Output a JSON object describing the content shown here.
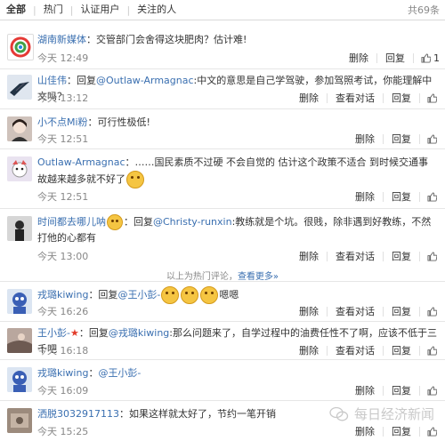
{
  "filters": {
    "tabs": [
      "全部",
      "热门",
      "认证用户",
      "关注的人"
    ],
    "count": "共69条"
  },
  "actions": {
    "delete": "删除",
    "reply": "回复",
    "view_conversation": "查看对话"
  },
  "comments": [
    {
      "user": "湖南新媒体",
      "text": "：交管部门会舍得这块肥肉？估计难!",
      "time": "今天 12:49",
      "likes": "1",
      "conversation": false
    },
    {
      "user": "山佳伟",
      "prefix": "：回复",
      "at": "@Outlaw-Armagnac",
      "text": ":中文的意思是自己学驾驶，参加驾照考试，你能理解中文吗？",
      "time": "今天 13:12",
      "conversation": true
    },
    {
      "user": "小不点Mi粉",
      "text": "：可行性极低!",
      "time": "今天 12:51",
      "conversation": false
    },
    {
      "user": "Outlaw-Armagnac",
      "text": "：……国民素质不过硬 不会自觉的 估计这个政策不适合 到时候交通事故越来越多就不好了",
      "time": "今天 12:51",
      "conversation": false
    },
    {
      "user": "时间都去哪儿呐",
      "prefix": "：回复",
      "at": "@Christy-runxin",
      "text": ":教练就是个坑。很贱，除非遇到好教练，不然打他的心都有",
      "time": "今天 13:00",
      "conversation": true
    },
    {
      "user": "戎璐kiwing",
      "prefix": "：回复",
      "at": "@王小彭-",
      "text": "嗯嗯",
      "time": "今天 16:26",
      "conversation": true
    },
    {
      "user": "王小彭-",
      "prefix": "：回复",
      "at": "@戎璐kiwing",
      "text": ":那么问题来了，自学过程中的油费任性不了啊，应该不低于三千吧",
      "time": "今天 16:18",
      "conversation": true
    },
    {
      "user": "戎璐kiwing",
      "at": "@王小彭-",
      "text": "",
      "time": "今天 16:09",
      "conversation": false
    },
    {
      "user": "洒脱3032917113",
      "text": "：如果这样就太好了，节约一笔开销",
      "time": "今天 15:25",
      "conversation": false
    }
  ],
  "hot_notice": {
    "text": "以上为热门评论，",
    "link": "查看更多»"
  },
  "watermark": "每日经济新闻"
}
